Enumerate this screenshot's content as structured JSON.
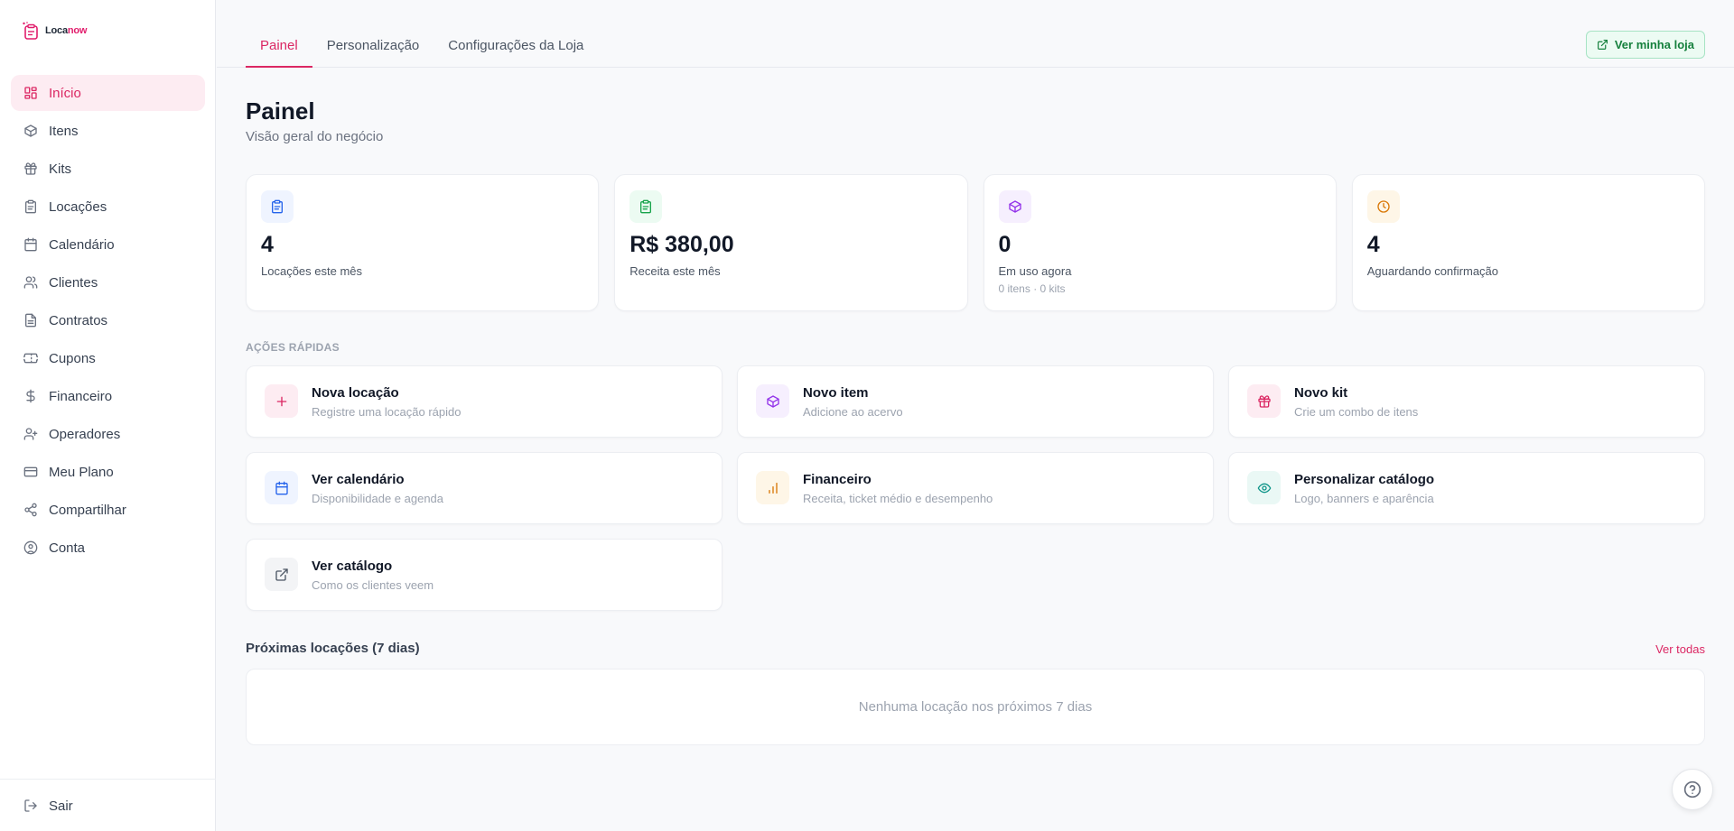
{
  "app": {
    "logo_prefix": "Loca",
    "logo_suffix": "now",
    "brand_color": "#db2763"
  },
  "sidebar": {
    "items": [
      {
        "label": "Início",
        "icon": "grid-icon",
        "active": true
      },
      {
        "label": "Itens",
        "icon": "box-icon"
      },
      {
        "label": "Kits",
        "icon": "gift-icon"
      },
      {
        "label": "Locações",
        "icon": "clipboard-icon"
      },
      {
        "label": "Calendário",
        "icon": "calendar-icon"
      },
      {
        "label": "Clientes",
        "icon": "users-icon"
      },
      {
        "label": "Contratos",
        "icon": "file-icon"
      },
      {
        "label": "Cupons",
        "icon": "ticket-icon"
      },
      {
        "label": "Financeiro",
        "icon": "dollar-icon"
      },
      {
        "label": "Operadores",
        "icon": "user-group-icon"
      },
      {
        "label": "Meu Plano",
        "icon": "credit-card-icon"
      },
      {
        "label": "Compartilhar",
        "icon": "share-icon"
      },
      {
        "label": "Conta",
        "icon": "user-circle-icon"
      }
    ],
    "logout_label": "Sair"
  },
  "header": {
    "tabs": [
      {
        "label": "Painel",
        "active": true
      },
      {
        "label": "Personalização"
      },
      {
        "label": "Configurações da Loja"
      }
    ],
    "store_button": "Ver minha loja"
  },
  "page": {
    "title": "Painel",
    "subtitle": "Visão geral do negócio"
  },
  "stats": [
    {
      "value": "4",
      "label": "Locações este mês",
      "sub": "",
      "icon": "clipboard-icon",
      "color": "#2563eb",
      "bg": "#eff4ff"
    },
    {
      "value": "R$ 380,00",
      "label": "Receita este mês",
      "sub": "",
      "icon": "clipboard-icon",
      "color": "#16a34a",
      "bg": "#ecfbf2"
    },
    {
      "value": "0",
      "label": "Em uso agora",
      "sub": "0 itens · 0 kits",
      "icon": "box-icon",
      "color": "#9333ea",
      "bg": "#f6effe"
    },
    {
      "value": "4",
      "label": "Aguardando confirmação",
      "sub": "",
      "icon": "clock-icon",
      "color": "#d97706",
      "bg": "#fef6e7"
    }
  ],
  "quick_actions": {
    "label": "AÇÕES RÁPIDAS",
    "items": [
      {
        "title": "Nova locação",
        "desc": "Registre uma locação rápido",
        "icon": "plus-icon",
        "color": "#db2763",
        "bg": "#fdecf2"
      },
      {
        "title": "Novo item",
        "desc": "Adicione ao acervo",
        "icon": "box-icon",
        "color": "#9333ea",
        "bg": "#f6effe"
      },
      {
        "title": "Novo kit",
        "desc": "Crie um combo de itens",
        "icon": "gift-icon",
        "color": "#db2763",
        "bg": "#fdecf2"
      },
      {
        "title": "Ver calendário",
        "desc": "Disponibilidade e agenda",
        "icon": "calendar-icon",
        "color": "#2563eb",
        "bg": "#eff4ff"
      },
      {
        "title": "Financeiro",
        "desc": "Receita, ticket médio e desempenho",
        "icon": "bar-chart-icon",
        "color": "#d97706",
        "bg": "#fef6e7"
      },
      {
        "title": "Personalizar catálogo",
        "desc": "Logo, banners e aparência",
        "icon": "eye-icon",
        "color": "#0d9488",
        "bg": "#eaf8f5"
      },
      {
        "title": "Ver catálogo",
        "desc": "Como os clientes veem",
        "icon": "external-link-icon",
        "color": "#4b5563",
        "bg": "#f3f4f6"
      }
    ]
  },
  "upcoming": {
    "title": "Próximas locações (7 dias)",
    "see_all": "Ver todas",
    "empty": "Nenhuma locação nos próximos 7 dias"
  }
}
